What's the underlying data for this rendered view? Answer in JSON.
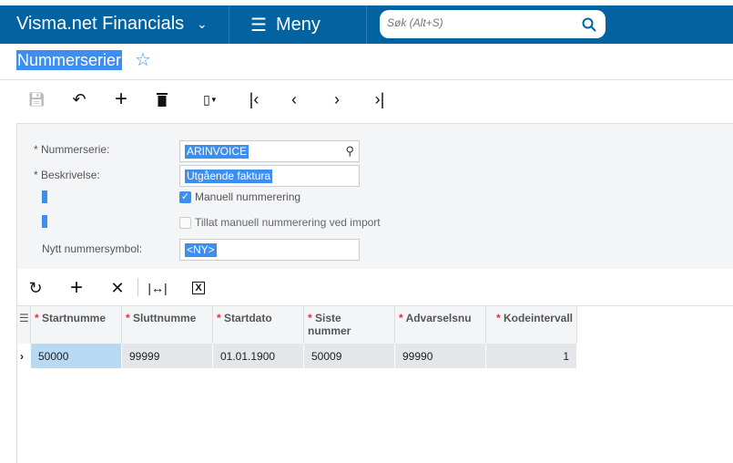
{
  "header": {
    "brand": "Visma.net Financials",
    "menu_label": "Meny",
    "search_placeholder": "Søk (Alt+S)"
  },
  "page": {
    "title": "Nummerserier"
  },
  "form": {
    "numberseries_label": "Nummerserie:",
    "numberseries_value": "ARINVOICE",
    "description_label": "Beskrivelse:",
    "description_value": "Utgående faktura",
    "manual_label": "Manuell nummerering",
    "manual_checked": true,
    "allow_import_label": "Tillat manuell nummerering ved import",
    "allow_import_checked": false,
    "new_symbol_label": "Nytt nummersymbol:",
    "new_symbol_value": "<NY>"
  },
  "grid": {
    "columns": [
      "Startnumme",
      "Sluttnumme",
      "Startdato",
      "Siste nummer",
      "Advarselsnu",
      "Kodeintervall"
    ],
    "rows": [
      [
        "50000",
        "99999",
        "01.01.1900",
        "50009",
        "99990",
        "1"
      ]
    ]
  },
  "colors": {
    "header": "#0362a0",
    "selection": "#3d8fef"
  }
}
